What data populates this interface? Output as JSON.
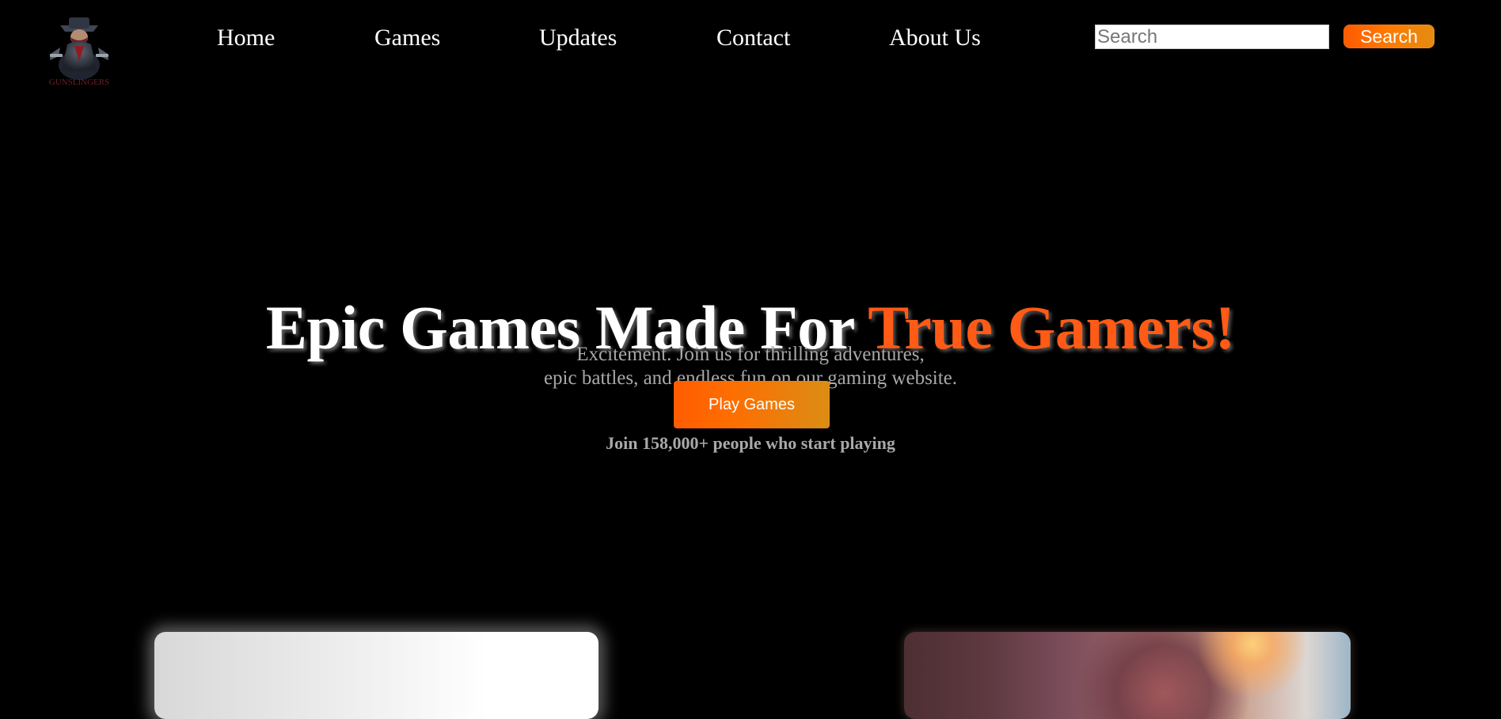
{
  "header": {
    "logo_alt": "Gunslingers",
    "nav": [
      {
        "label": "Home"
      },
      {
        "label": "Games"
      },
      {
        "label": "Updates"
      },
      {
        "label": "Contact"
      },
      {
        "label": "About Us"
      }
    ],
    "search": {
      "placeholder": "Search",
      "button_label": "Search"
    }
  },
  "hero": {
    "title_main": "Epic Games Made For ",
    "title_accent": "True Gamers!",
    "subtitle_line1": "Excitement. Join us for thrilling adventures,",
    "subtitle_line2": "epic battles, and endless fun on our gaming website.",
    "cta_label": "Play Games",
    "join_text": "Join 158,000+ people who start playing"
  },
  "colors": {
    "background": "#000000",
    "accent": "#ff5a16",
    "button_gradient_start": "#ff5c00",
    "button_gradient_end": "#db8d15"
  },
  "icons": {
    "logo": "gunslinger-logo-icon"
  }
}
